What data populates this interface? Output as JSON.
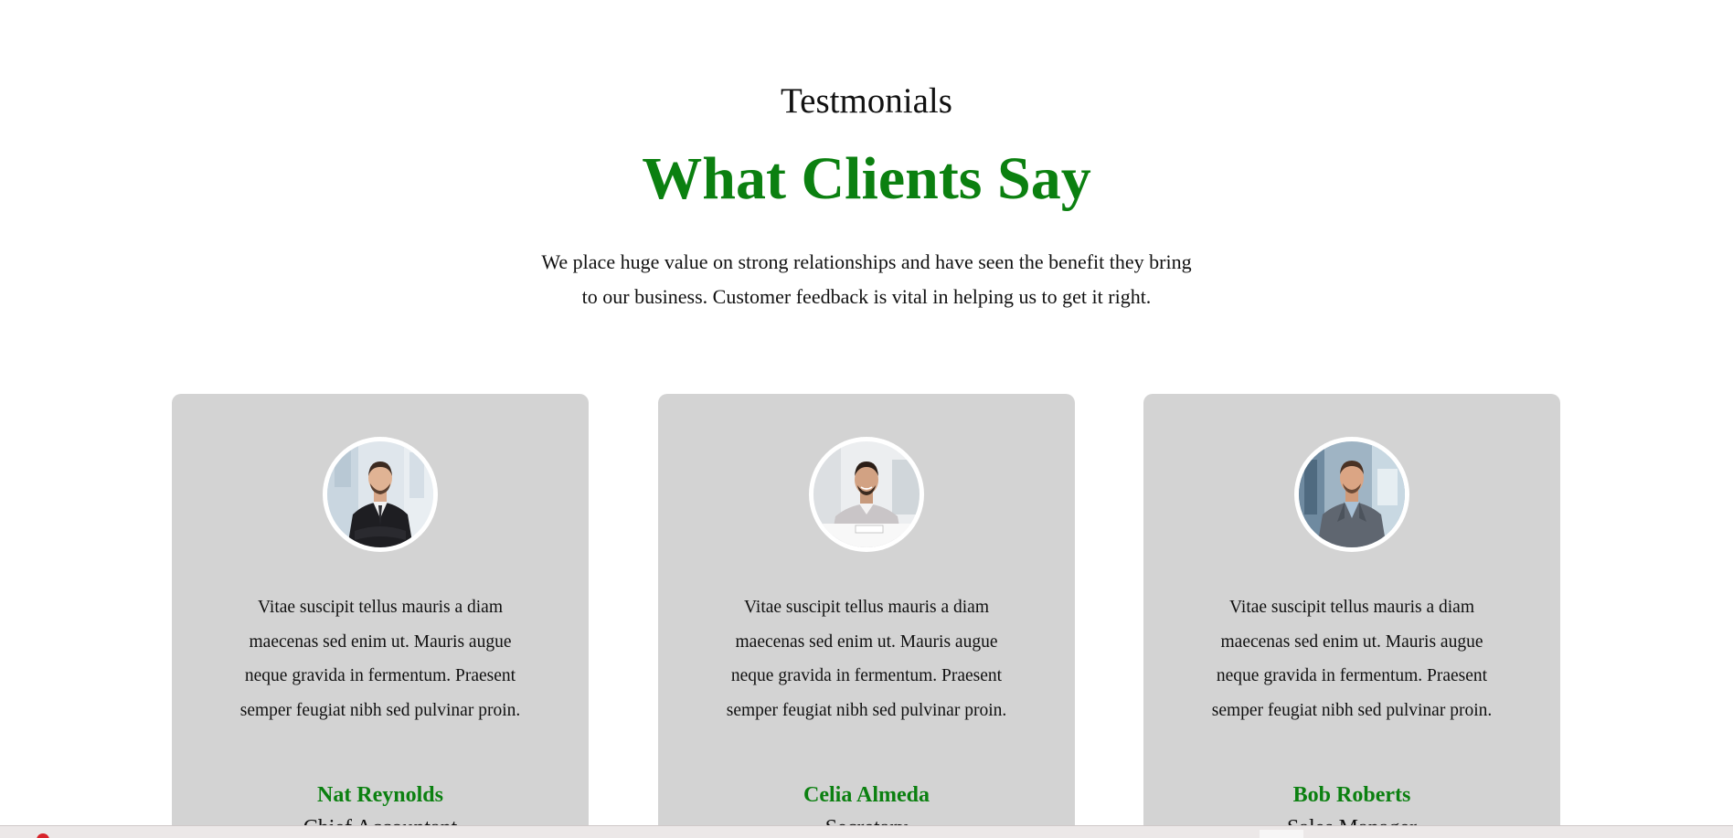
{
  "section": {
    "eyebrow": "Testmonials",
    "title": "What Clients Say",
    "intro": "We place huge value on strong relationships and have seen the benefit they bring to our business. Customer feedback is vital in helping us to get it right."
  },
  "colors": {
    "accent": "#0b8010",
    "card_background": "#d3d3d3",
    "text": "#111111"
  },
  "testimonials": [
    {
      "quote": "Vitae suscipit tellus mauris a diam maecenas sed enim ut. Mauris augue neque gravida in fermentum. Praesent semper feugiat nibh sed pulvinar proin.",
      "name": "Nat Reynolds",
      "role": "Chief Accountant",
      "avatar_icon": "client-photo-man-crossed-arms"
    },
    {
      "quote": "Vitae suscipit tellus mauris a diam maecenas sed enim ut. Mauris augue neque gravida in fermentum. Praesent semper feugiat nibh sed pulvinar proin.",
      "name": "Celia Almeda",
      "role": "Secretary",
      "avatar_icon": "client-photo-man-at-desk"
    },
    {
      "quote": "Vitae suscipit tellus mauris a diam maecenas sed enim ut. Mauris augue neque gravida in fermentum. Praesent semper feugiat nibh sed pulvinar proin.",
      "name": "Bob Roberts",
      "role": "Sales Manager",
      "avatar_icon": "client-photo-man-in-office"
    }
  ]
}
